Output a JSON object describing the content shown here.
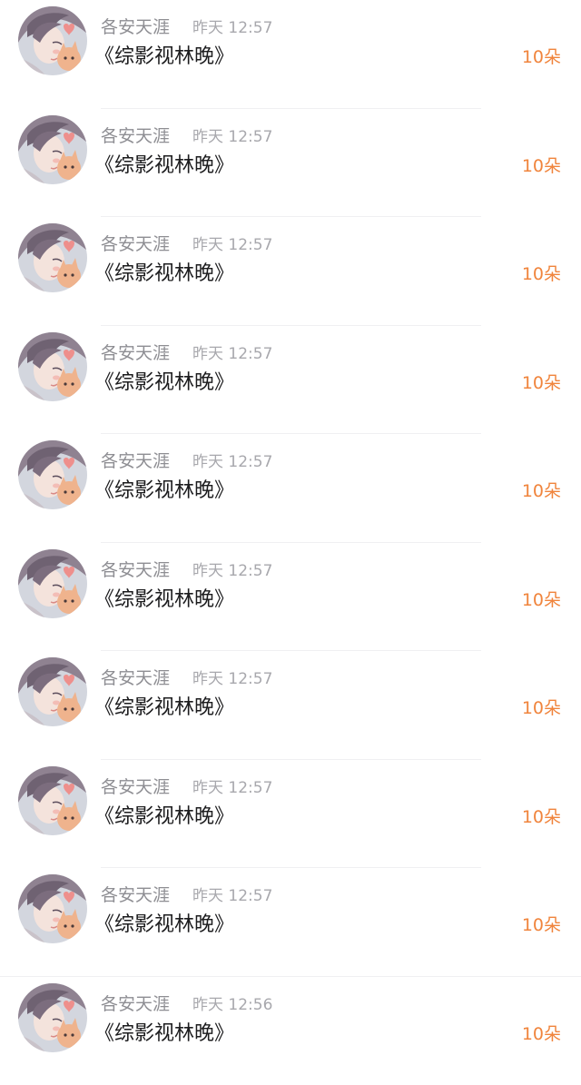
{
  "items": [
    {
      "name": "各安天涯",
      "time": "昨天 12:57",
      "title": "《综影视林晚》",
      "amount": "10朵"
    },
    {
      "name": "各安天涯",
      "time": "昨天 12:57",
      "title": "《综影视林晚》",
      "amount": "10朵"
    },
    {
      "name": "各安天涯",
      "time": "昨天 12:57",
      "title": "《综影视林晚》",
      "amount": "10朵"
    },
    {
      "name": "各安天涯",
      "time": "昨天 12:57",
      "title": "《综影视林晚》",
      "amount": "10朵"
    },
    {
      "name": "各安天涯",
      "time": "昨天 12:57",
      "title": "《综影视林晚》",
      "amount": "10朵"
    },
    {
      "name": "各安天涯",
      "time": "昨天 12:57",
      "title": "《综影视林晚》",
      "amount": "10朵"
    },
    {
      "name": "各安天涯",
      "time": "昨天 12:57",
      "title": "《综影视林晚》",
      "amount": "10朵"
    },
    {
      "name": "各安天涯",
      "time": "昨天 12:57",
      "title": "《综影视林晚》",
      "amount": "10朵"
    },
    {
      "name": "各安天涯",
      "time": "昨天 12:57",
      "title": "《综影视林晚》",
      "amount": "10朵"
    },
    {
      "name": "各安天涯",
      "time": "昨天 12:56",
      "title": "《综影视林晚》",
      "amount": "10朵"
    }
  ],
  "colors": {
    "name": "#8e8e93",
    "time": "#a8a8ad",
    "title": "#1c1c1e",
    "amount": "#f0843c"
  },
  "icons": {
    "avatar": "avatar-illustration-icon"
  }
}
